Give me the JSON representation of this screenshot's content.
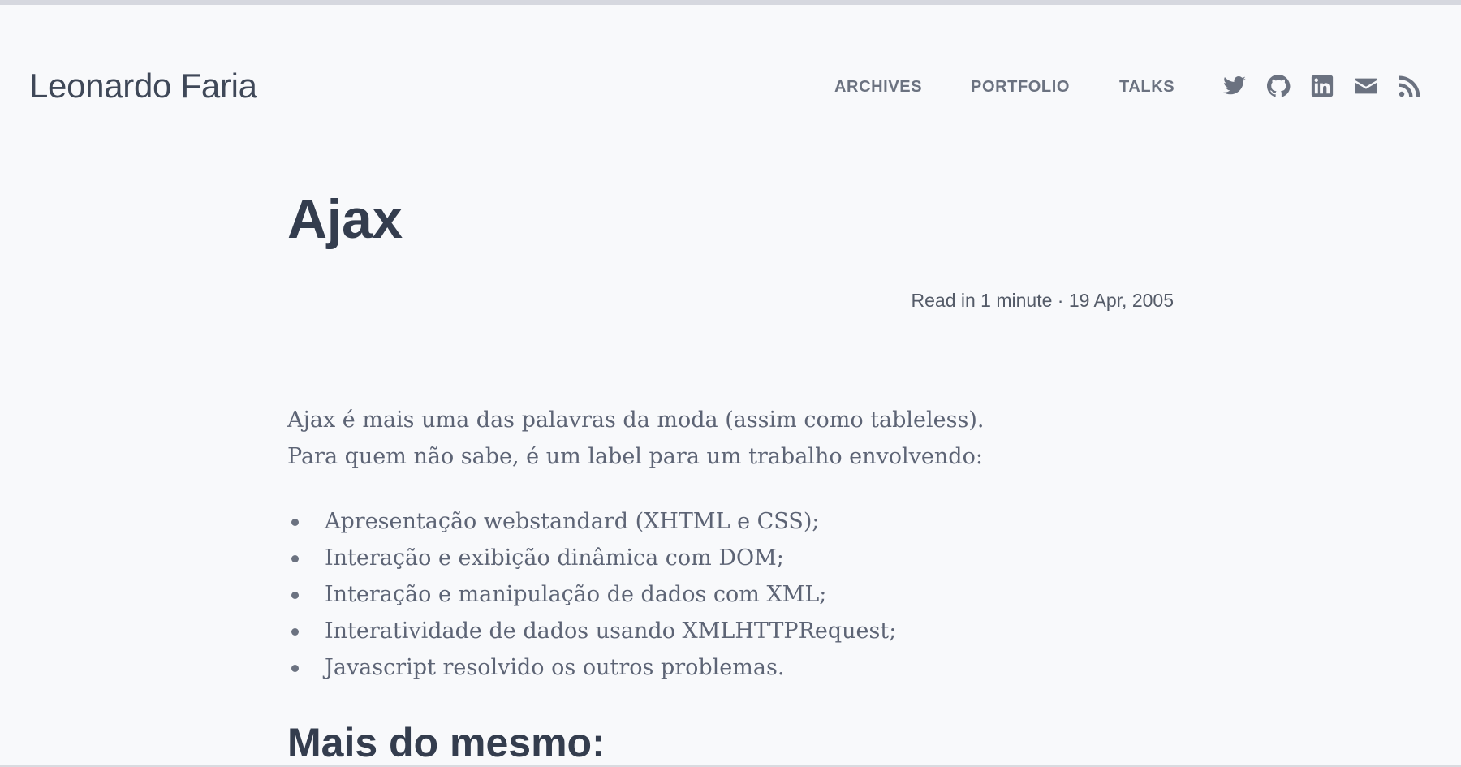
{
  "header": {
    "site_title": "Leonardo Faria",
    "nav": {
      "archives": "ARCHIVES",
      "portfolio": "PORTFOLIO",
      "talks": "TALKS"
    },
    "social_icons": [
      "twitter-icon",
      "github-icon",
      "linkedin-icon",
      "email-icon",
      "rss-icon"
    ]
  },
  "post": {
    "title": "Ajax",
    "meta": "Read in 1 minute · 19 Apr, 2005",
    "intro_line_1": "Ajax é mais uma das palavras da moda (assim como tableless).",
    "intro_line_2": "Para quem não sabe, é um label para um trabalho envolvendo:",
    "list": [
      "Apresentação webstandard (XHTML e CSS);",
      "Interação e exibição dinâmica com DOM;",
      "Interação e manipulação de dados com XML;",
      "Interatividade de dados usando XMLHTTPRequest;",
      "Javascript resolvido os outros problemas."
    ],
    "section_heading": "Mais do mesmo:"
  },
  "colors": {
    "background": "#f8f9fb",
    "heading": "#343d4e",
    "nav": "#6b7280",
    "body_text": "#5d6475"
  }
}
